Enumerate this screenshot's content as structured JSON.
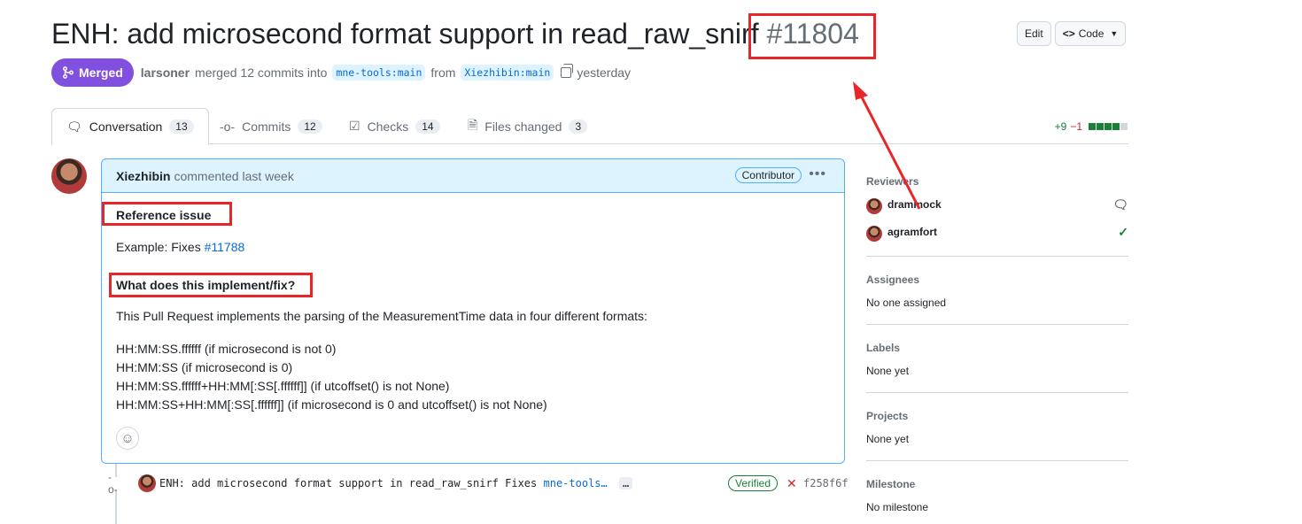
{
  "header": {
    "title": "ENH: add microsecond format support in read_raw_snirf",
    "number": "#11804",
    "edit_label": "Edit",
    "code_label": "Code"
  },
  "meta": {
    "state_label": "Merged",
    "author": "larsoner",
    "action_text": "merged 12 commits into",
    "base_branch": "mne-tools:main",
    "from_text": "from",
    "head_branch": "Xiezhibin:main",
    "time": "yesterday"
  },
  "tabs": [
    {
      "label": "Conversation",
      "count": "13"
    },
    {
      "label": "Commits",
      "count": "12"
    },
    {
      "label": "Checks",
      "count": "14"
    },
    {
      "label": "Files changed",
      "count": "3"
    }
  ],
  "diffstat": {
    "additions": "+9",
    "deletions": "−1"
  },
  "comment": {
    "author": "Xiezhibin",
    "meta": "commented last week",
    "role_badge": "Contributor",
    "heading1": "Reference issue",
    "example_prefix": "Example: Fixes",
    "example_link": "#11788",
    "heading2": "What does this implement/fix?",
    "intro": "This Pull Request implements the parsing of the MeasurementTime data in four different formats:",
    "formats": [
      "HH:MM:SS.ffffff (if microsecond is not 0)",
      "HH:MM:SS (if microsecond is 0)",
      "HH:MM:SS.ffffff+HH:MM[:SS[.ffffff]] (if utcoffset() is not None)",
      "HH:MM:SS+HH:MM[:SS[.ffffff]] (if microsecond is 0 and utcoffset() is not None)"
    ]
  },
  "commit": {
    "message": "ENH: add microsecond format support in read_raw_snirf Fixes",
    "link": "mne-tools…",
    "more": "…",
    "verified": "Verified",
    "sha": "f258f6f"
  },
  "sidebar": {
    "reviewers_title": "Reviewers",
    "reviewers": [
      {
        "name": "drammock",
        "status": "commented"
      },
      {
        "name": "agramfort",
        "status": "approved"
      }
    ],
    "assignees_title": "Assignees",
    "assignees_value": "No one assigned",
    "labels_title": "Labels",
    "labels_value": "None yet",
    "projects_title": "Projects",
    "projects_value": "None yet",
    "milestone_title": "Milestone",
    "milestone_value": "No milestone"
  },
  "colors": {
    "merged": "#8250df",
    "annotation": "#e8262a",
    "link": "#0969da",
    "success": "#1a7f37"
  }
}
